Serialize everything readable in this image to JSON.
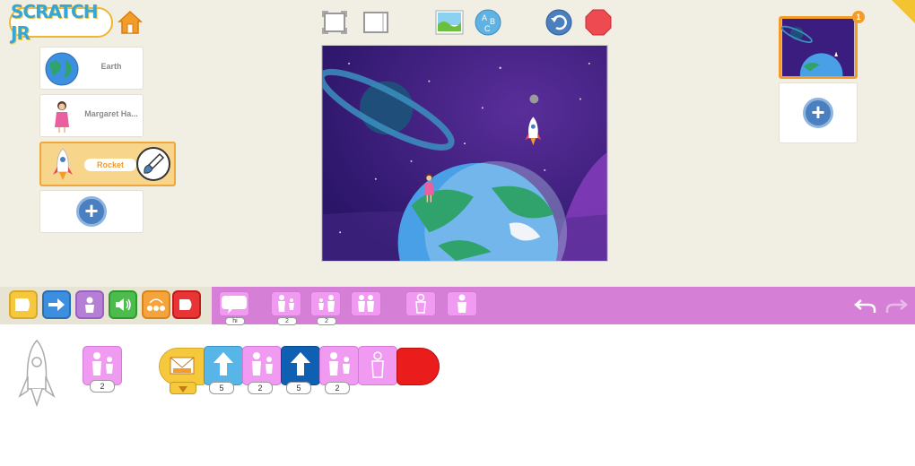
{
  "app": {
    "logo": "SCRATCH JR"
  },
  "sprites": [
    {
      "name": "Earth",
      "icon": "earth-icon"
    },
    {
      "name": "Margaret Ha...",
      "icon": "person-icon"
    },
    {
      "name": "Rocket",
      "icon": "rocket-icon",
      "selected": true
    }
  ],
  "pages": [
    {
      "number": "1"
    }
  ],
  "palette": {
    "say_badge": "hi",
    "grow_badge": "2",
    "shrink_badge": "2"
  },
  "script": {
    "loose_block_badge": "2",
    "blocks": [
      {
        "type": "receive-message",
        "color": "#f6c93d"
      },
      {
        "type": "move-up",
        "badge": "5",
        "color": "#58b5e8"
      },
      {
        "type": "grow",
        "badge": "2",
        "color": "#f19af2"
      },
      {
        "type": "move-up",
        "badge": "5",
        "color": "#0f5fb3"
      },
      {
        "type": "grow",
        "badge": "2",
        "color": "#f19af2"
      },
      {
        "type": "show",
        "color": "#f19af2"
      },
      {
        "type": "end",
        "color": "#ea1c1c"
      }
    ]
  },
  "colors": {
    "accent": "#f29c2a",
    "palette_looks": "#d57fd6",
    "bg": "#f1efe4"
  }
}
